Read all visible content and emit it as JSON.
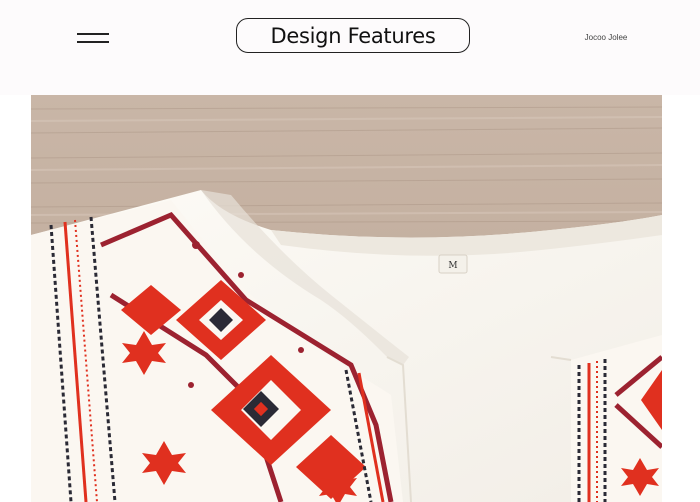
{
  "header": {
    "title": "Design Features",
    "brand": "Jocoo Jolee"
  },
  "photo": {
    "tag_label": "M"
  },
  "icons": {
    "menu": "hamburger-menu-icon"
  },
  "colors": {
    "background": "#fdfbfc",
    "wood": "#c8b4a4",
    "fabric": "#fbf8f3",
    "pattern_red": "#e0301f",
    "pattern_dark": "#2a2a35",
    "pattern_maroon": "#9c2230"
  }
}
